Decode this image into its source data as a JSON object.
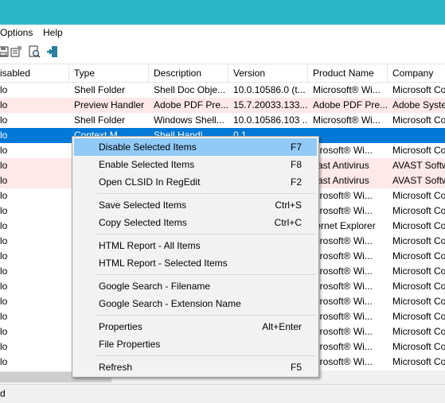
{
  "menu": {
    "options": "Options",
    "help": "Help"
  },
  "columns": [
    "isabled",
    "Type",
    "Description",
    "Version",
    "Product Name",
    "Company"
  ],
  "rows": [
    {
      "disabled": "lo",
      "type": "Shell Folder",
      "description": "Shell Doc Obje...",
      "version": "10.0.10586.0 (t...",
      "product": "Microsoft® Wi...",
      "company": "Microsoft Co",
      "style": "normal"
    },
    {
      "disabled": "lo",
      "type": "Preview Handler",
      "description": "Adobe PDF Pre...",
      "version": "15.7.20033.133...",
      "product": "Adobe PDF Pre...",
      "company": "Adobe Syste",
      "style": "pink"
    },
    {
      "disabled": "lo",
      "type": "Shell Folder",
      "description": "Windows Shell...",
      "version": "10.0.10586.103 ...",
      "product": "Microsoft® Wi...",
      "company": "Microsoft Co",
      "style": "normal"
    },
    {
      "disabled": "lo",
      "type": "Context M...",
      "description": "Shell Handl...",
      "version": "0.1",
      "product": "",
      "company": "",
      "style": "sel"
    },
    {
      "disabled": "lo",
      "type": "",
      "description": "",
      "version": "",
      "product": "icrosoft® Wi...",
      "company": "Microsoft Co",
      "style": "normal"
    },
    {
      "disabled": "lo",
      "type": "",
      "description": "",
      "version": "",
      "product": "vast Antivirus",
      "company": "AVAST Softw",
      "style": "pink"
    },
    {
      "disabled": "lo",
      "type": "",
      "description": "",
      "version": "",
      "product": "vast Antivirus",
      "company": "AVAST Softw",
      "style": "pink"
    },
    {
      "disabled": "lo",
      "type": "",
      "description": "",
      "version": "",
      "product": "icrosoft® Wi...",
      "company": "Microsoft Co",
      "style": "normal"
    },
    {
      "disabled": "lo",
      "type": "",
      "description": "",
      "version": "",
      "product": "icrosoft® Wi...",
      "company": "Microsoft Co",
      "style": "normal"
    },
    {
      "disabled": "lo",
      "type": "",
      "description": "",
      "version": "",
      "product": "ternet Explorer",
      "company": "Microsoft Co",
      "style": "normal"
    },
    {
      "disabled": "lo",
      "type": "",
      "description": "",
      "version": "",
      "product": "icrosoft® Wi...",
      "company": "Microsoft Co",
      "style": "normal"
    },
    {
      "disabled": "lo",
      "type": "",
      "description": "",
      "version": "",
      "product": "icrosoft® Wi...",
      "company": "Microsoft Co",
      "style": "normal"
    },
    {
      "disabled": "lo",
      "type": "",
      "description": "",
      "version": "",
      "product": "icrosoft® Wi...",
      "company": "Microsoft Co",
      "style": "normal"
    },
    {
      "disabled": "lo",
      "type": "",
      "description": "",
      "version": "",
      "product": "icrosoft® Wi...",
      "company": "Microsoft Co",
      "style": "normal"
    },
    {
      "disabled": "lo",
      "type": "",
      "description": "",
      "version": "",
      "product": "icrosoft® Wi...",
      "company": "Microsoft Co",
      "style": "normal"
    },
    {
      "disabled": "lo",
      "type": "",
      "description": "",
      "version": "",
      "product": "icrosoft® Wi...",
      "company": "Microsoft Co",
      "style": "normal"
    },
    {
      "disabled": "lo",
      "type": "",
      "description": "",
      "version": "",
      "product": "icrosoft® Wi...",
      "company": "Microsoft Co",
      "style": "normal"
    },
    {
      "disabled": "lo",
      "type": "",
      "description": "",
      "version": "",
      "product": "icrosoft® Wi...",
      "company": "Microsoft Co",
      "style": "normal"
    },
    {
      "disabled": "lo",
      "type": "",
      "description": "",
      "version": "",
      "product": "icrosoft® Wi...",
      "company": "Microsoft Co",
      "style": "normal"
    }
  ],
  "context_menu": [
    {
      "label": "Disable Selected Items",
      "shortcut": "F7",
      "highlighted": true
    },
    {
      "label": "Enable Selected Items",
      "shortcut": "F8"
    },
    {
      "label": "Open CLSID In RegEdit",
      "shortcut": "F2"
    },
    {
      "separator": true
    },
    {
      "label": "Save Selected Items",
      "shortcut": "Ctrl+S"
    },
    {
      "label": "Copy Selected Items",
      "shortcut": "Ctrl+C"
    },
    {
      "separator": true
    },
    {
      "label": "HTML Report - All Items",
      "shortcut": ""
    },
    {
      "label": "HTML Report - Selected Items",
      "shortcut": ""
    },
    {
      "separator": true
    },
    {
      "label": "Google Search - Filename",
      "shortcut": ""
    },
    {
      "label": "Google Search - Extension Name",
      "shortcut": ""
    },
    {
      "separator": true
    },
    {
      "label": "Properties",
      "shortcut": "Alt+Enter"
    },
    {
      "label": "File Properties",
      "shortcut": ""
    },
    {
      "separator": true
    },
    {
      "label": "Refresh",
      "shortcut": "F5"
    }
  ],
  "status": {
    "text": "d"
  },
  "colors": {
    "titlebar": "#2bb6c6",
    "selection": "#0078d7",
    "pink_row": "#ffe8e8",
    "menu_highlight": "#91c9f7"
  },
  "toolbar_icons": [
    "save-icon",
    "properties-icon",
    "html-report-icon",
    "exit-icon"
  ]
}
